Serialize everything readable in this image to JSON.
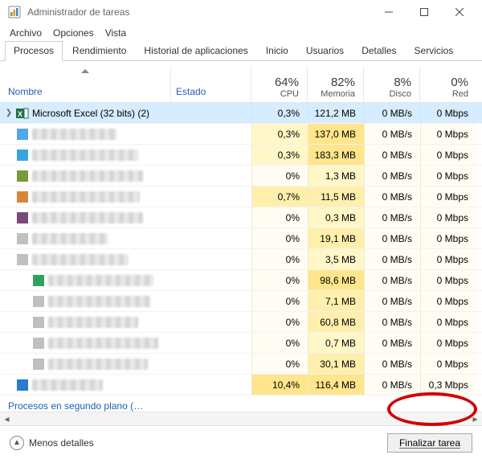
{
  "window": {
    "title": "Administrador de tareas"
  },
  "menu": {
    "file": "Archivo",
    "options": "Opciones",
    "view": "Vista"
  },
  "tabs": [
    {
      "label": "Procesos",
      "active": true
    },
    {
      "label": "Rendimiento"
    },
    {
      "label": "Historial de aplicaciones"
    },
    {
      "label": "Inicio"
    },
    {
      "label": "Usuarios"
    },
    {
      "label": "Detalles"
    },
    {
      "label": "Servicios"
    }
  ],
  "columns": {
    "name": "Nombre",
    "state": "Estado",
    "cpu": {
      "pct": "64%",
      "label": "CPU"
    },
    "memory": {
      "pct": "82%",
      "label": "Memoria"
    },
    "disk": {
      "pct": "8%",
      "label": "Disco"
    },
    "net": {
      "pct": "0%",
      "label": "Red"
    }
  },
  "rows": [
    {
      "kind": "named",
      "selected": true,
      "expand": true,
      "icon": {
        "type": "excel"
      },
      "name": "Microsoft Excel (32 bits) (2)",
      "cpu": "0,3%",
      "mem": "121,2 MB",
      "disk": "0 MB/s",
      "net": "0 Mbps",
      "cpuHeat": 1,
      "memHeat": 3
    },
    {
      "kind": "blur",
      "chip": "#50a8e8",
      "cpu": "0,3%",
      "mem": "137,0 MB",
      "disk": "0 MB/s",
      "net": "0 Mbps",
      "cpuHeat": 1,
      "memHeat": 3
    },
    {
      "kind": "blur",
      "chip": "#37a4e0",
      "cpu": "0,3%",
      "mem": "183,3 MB",
      "disk": "0 MB/s",
      "net": "0 Mbps",
      "cpuHeat": 1,
      "memHeat": 3
    },
    {
      "kind": "blur",
      "chip": "#7a9a3a",
      "cpu": "0%",
      "mem": "1,3 MB",
      "disk": "0 MB/s",
      "net": "0 Mbps",
      "cpuHeat": 0,
      "memHeat": 1
    },
    {
      "kind": "blur",
      "chip": "#d8863a",
      "cpu": "0,7%",
      "mem": "11,5 MB",
      "disk": "0 MB/s",
      "net": "0 Mbps",
      "cpuHeat": 2,
      "memHeat": 2
    },
    {
      "kind": "blur",
      "chip": "#7a4a7a",
      "cpu": "0%",
      "mem": "0,3 MB",
      "disk": "0 MB/s",
      "net": "0 Mbps",
      "cpuHeat": 0,
      "memHeat": 1
    },
    {
      "kind": "blur",
      "chip": "#c0c0c0",
      "cpu": "0%",
      "mem": "19,1 MB",
      "disk": "0 MB/s",
      "net": "0 Mbps",
      "cpuHeat": 0,
      "memHeat": 2
    },
    {
      "kind": "blur",
      "chip": "#c0c0c0",
      "cpu": "0%",
      "mem": "3,5 MB",
      "disk": "0 MB/s",
      "net": "0 Mbps",
      "cpuHeat": 0,
      "memHeat": 1
    },
    {
      "kind": "blur",
      "chip": "#2fa35a",
      "indent": true,
      "cpu": "0%",
      "mem": "98,6 MB",
      "disk": "0 MB/s",
      "net": "0 Mbps",
      "cpuHeat": 0,
      "memHeat": 3
    },
    {
      "kind": "blur",
      "chip": "#c0c0c0",
      "indent": true,
      "cpu": "0%",
      "mem": "7,1 MB",
      "disk": "0 MB/s",
      "net": "0 Mbps",
      "cpuHeat": 0,
      "memHeat": 2
    },
    {
      "kind": "blur",
      "chip": "#c0c0c0",
      "indent": true,
      "cpu": "0%",
      "mem": "60,8 MB",
      "disk": "0 MB/s",
      "net": "0 Mbps",
      "cpuHeat": 0,
      "memHeat": 2
    },
    {
      "kind": "blur",
      "chip": "#c0c0c0",
      "indent": true,
      "cpu": "0%",
      "mem": "0,7 MB",
      "disk": "0 MB/s",
      "net": "0 Mbps",
      "cpuHeat": 0,
      "memHeat": 1
    },
    {
      "kind": "blur",
      "chip": "#c0c0c0",
      "indent": true,
      "cpu": "0%",
      "mem": "30,1 MB",
      "disk": "0 MB/s",
      "net": "0 Mbps",
      "cpuHeat": 0,
      "memHeat": 2
    },
    {
      "kind": "blur",
      "chip": "#2a7cd0",
      "cpu": "10,4%",
      "mem": "116,4 MB",
      "disk": "0 MB/s",
      "net": "0,3 Mbps",
      "cpuHeat": 3,
      "memHeat": 3
    }
  ],
  "truncated_group": "Procesos en segundo plano (…",
  "footer": {
    "fewer_details": "Menos detalles",
    "end_task": "Finalizar tarea"
  }
}
